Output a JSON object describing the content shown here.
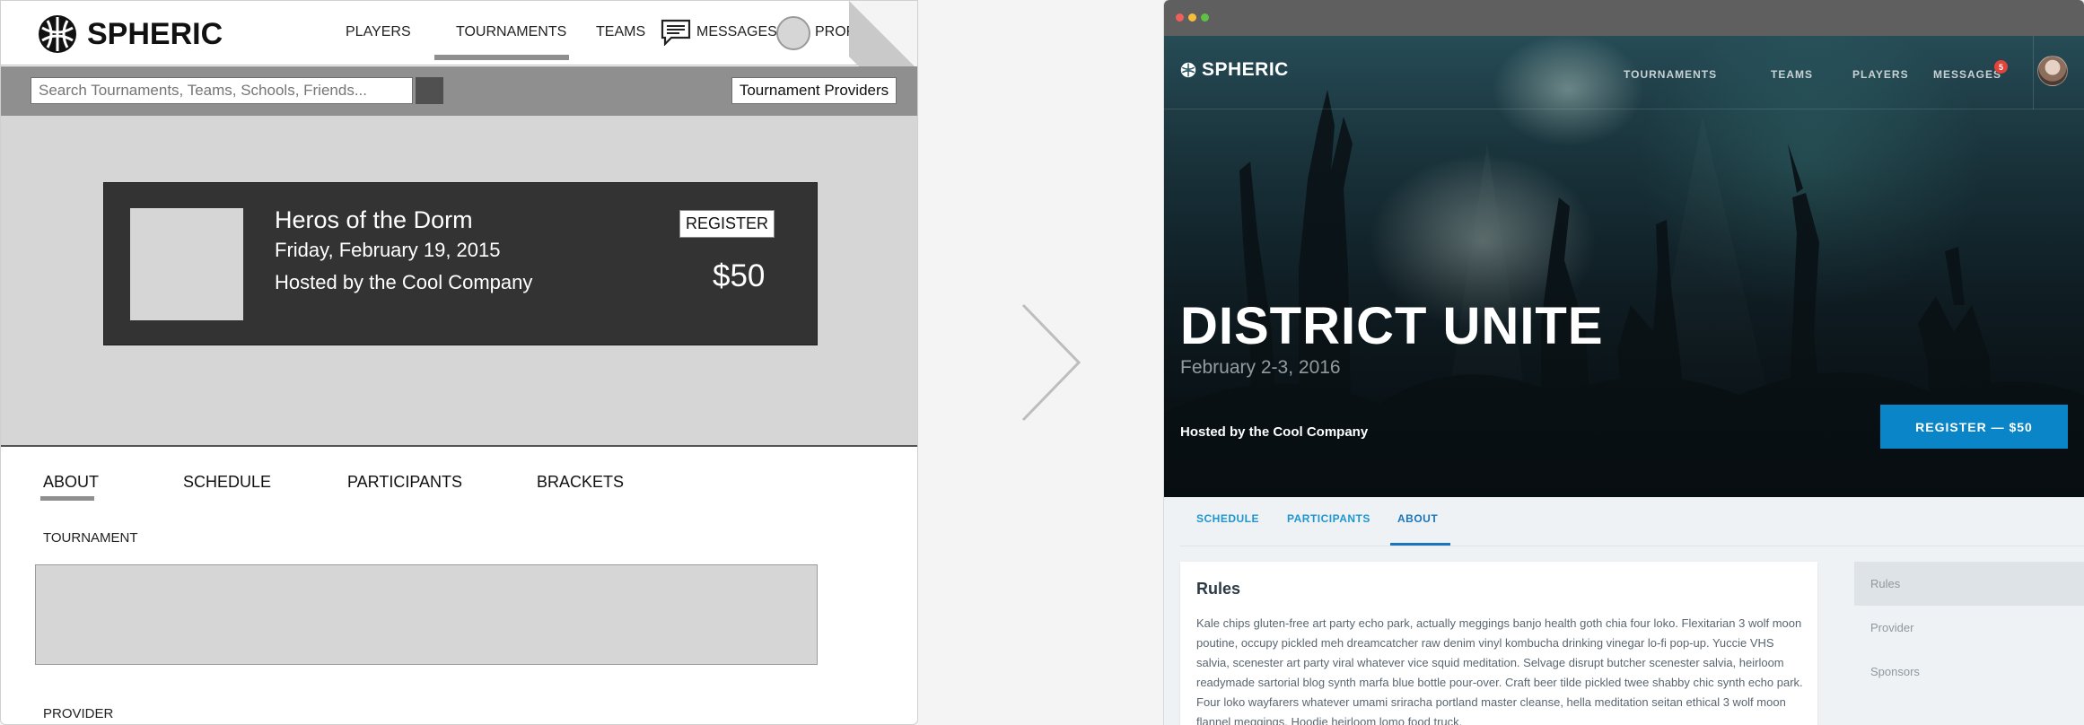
{
  "wireframe": {
    "logo": "SPHERIC",
    "nav": {
      "players": "PLAYERS",
      "tournaments": "TOURNAMENTS",
      "teams": "TEAMS",
      "messages": "MESSAGES",
      "profile": "PROFI"
    },
    "search": {
      "placeholder": "Search Tournaments, Teams, Schools, Friends..."
    },
    "providers_button": "Tournament Providers",
    "event": {
      "title": "Heros of the Dorm",
      "date": "Friday, February 19, 2015",
      "host": "Hosted by the Cool Company",
      "register": "REGISTER",
      "price": "$50"
    },
    "tabs": [
      "ABOUT",
      "SCHEDULE",
      "PARTICIPANTS",
      "BRACKETS"
    ],
    "section_tournament": "TOURNAMENT",
    "section_provider": "PROVIDER"
  },
  "design": {
    "logo": "SPHERIC",
    "nav": {
      "tournaments": "TOURNAMENTS",
      "teams": "TEAMS",
      "players": "PLAYERS",
      "messages": "MESSAGES",
      "message_count": "5"
    },
    "event": {
      "title": "DISTRICT UNITE",
      "date": "February 2-3, 2016",
      "host": "Hosted by the Cool Company",
      "register": "REGISTER — $50"
    },
    "tabs": [
      "SCHEDULE",
      "PARTICIPANTS",
      "ABOUT"
    ],
    "rules": {
      "title": "Rules",
      "text": "Kale chips gluten-free art party echo park, actually meggings banjo health goth chia four loko. Flexitarian 3 wolf moon poutine, occupy pickled meh dreamcatcher raw denim vinyl kombucha drinking vinegar lo-fi pop-up. Yuccie VHS salvia, scenester art party viral whatever vice squid meditation. Selvage disrupt butcher scenester salvia, heirloom readymade sartorial blog synth marfa blue bottle pour-over. Craft beer tilde pickled twee shabby chic synth echo park. Four loko wayfarers whatever umami sriracha portland master cleanse, hella meditation seitan ethical 3 wolf moon flannel meggings. Hoodie heirloom lomo food truck."
    },
    "sidebar": [
      "Rules",
      "Provider",
      "Sponsors"
    ],
    "colors": {
      "accent": "#1b75bb",
      "register_button": "#0a86c8",
      "badge": "#e0443a"
    }
  }
}
